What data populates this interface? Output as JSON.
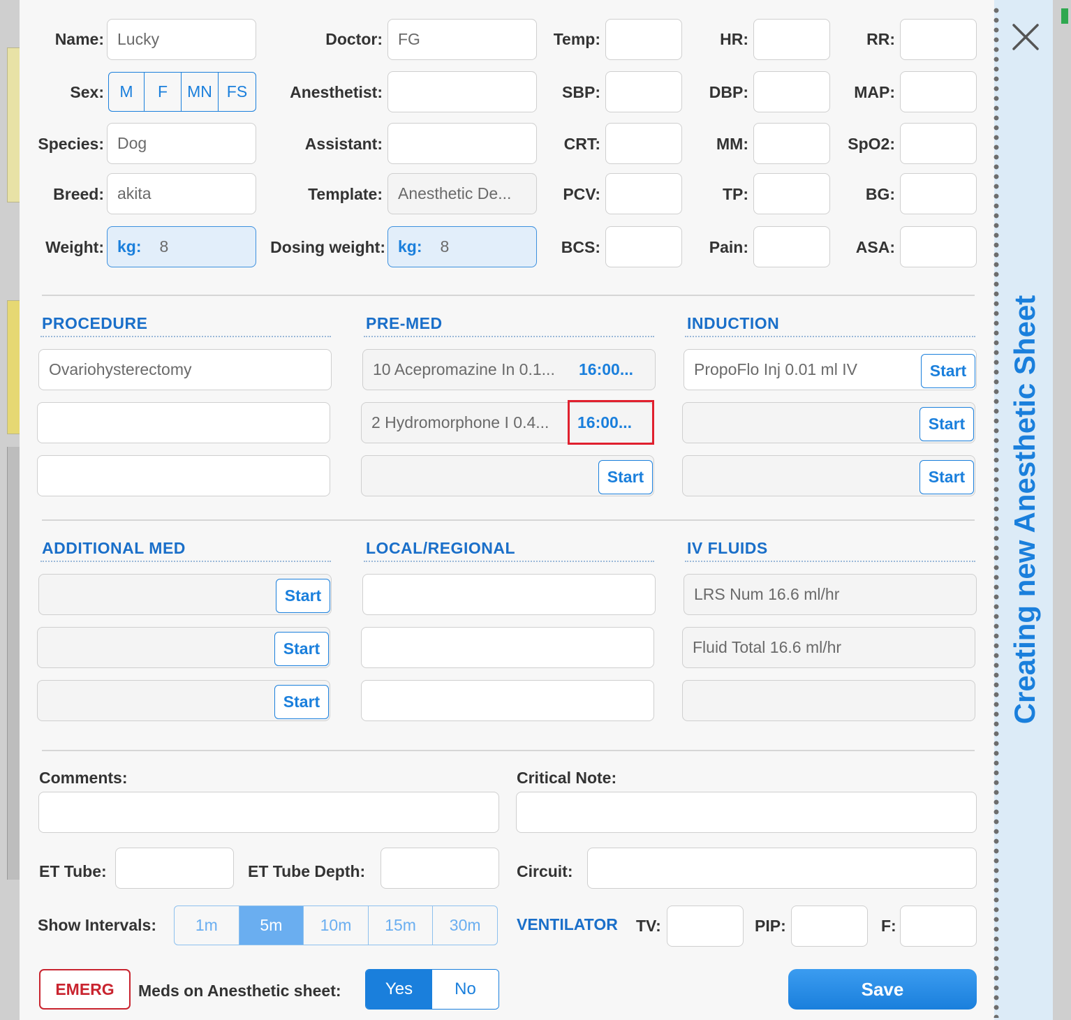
{
  "dialog": {
    "sidebar_title": "Creating new Anesthetic Sheet",
    "close_icon": "close-icon"
  },
  "patient": {
    "name_label": "Name:",
    "name_value": "Lucky",
    "sex_label": "Sex:",
    "sex_options": [
      "M",
      "F",
      "MN",
      "FS"
    ],
    "species_label": "Species:",
    "species_value": "Dog",
    "breed_label": "Breed:",
    "breed_value": "akita",
    "weight_label": "Weight:",
    "weight_unit": "kg:",
    "weight_value": "8",
    "doctor_label": "Doctor:",
    "doctor_value": "FG",
    "anesthetist_label": "Anesthetist:",
    "anesthetist_value": "",
    "assistant_label": "Assistant:",
    "assistant_value": "",
    "template_label": "Template:",
    "template_value": "Anesthetic De...",
    "dosing_weight_label": "Dosing weight:",
    "dosing_weight_unit": "kg:",
    "dosing_weight_value": "8"
  },
  "vitals": {
    "temp": "Temp:",
    "hr": "HR:",
    "rr": "RR:",
    "sbp": "SBP:",
    "dbp": "DBP:",
    "map": "MAP:",
    "crt": "CRT:",
    "mm": "MM:",
    "spo2": "SpO2:",
    "pcv": "PCV:",
    "tp": "TP:",
    "bg": "BG:",
    "bcs": "BCS:",
    "pain": "Pain:",
    "asa": "ASA:"
  },
  "procedure": {
    "title": "PROCEDURE",
    "items": [
      "Ovariohysterectomy",
      "",
      ""
    ]
  },
  "premed": {
    "title": "PRE-MED",
    "items": [
      {
        "text": "10 Acepromazine In 0.1...",
        "time": "16:00..."
      },
      {
        "text": "2 Hydromorphone I 0.4...",
        "time": "16:00..."
      }
    ],
    "start_label": "Start"
  },
  "induction": {
    "title": "INDUCTION",
    "items": [
      "PropoFlo Inj 0.01 ml IV",
      "",
      ""
    ],
    "start_label": "Start"
  },
  "additional_med": {
    "title": "ADDITIONAL MED",
    "start_label": "Start"
  },
  "local_regional": {
    "title": "LOCAL/REGIONAL"
  },
  "iv_fluids": {
    "title": "IV FLUIDS",
    "items": [
      "LRS Num 16.6 ml/hr",
      "Fluid Total 16.6 ml/hr",
      ""
    ]
  },
  "bottom": {
    "comments_label": "Comments:",
    "critical_note_label": "Critical Note:",
    "et_tube_label": "ET Tube:",
    "et_tube_depth_label": "ET Tube Depth:",
    "circuit_label": "Circuit:",
    "show_intervals_label": "Show Intervals:",
    "intervals": [
      "1m",
      "5m",
      "10m",
      "15m",
      "30m"
    ],
    "selected_interval": "5m",
    "ventilator_label": "VENTILATOR",
    "tv_label": "TV:",
    "pip_label": "PIP:",
    "f_label": "F:",
    "emerg_label": "EMERG",
    "meds_label": "Meds on Anesthetic sheet:",
    "yes_label": "Yes",
    "no_label": "No",
    "save_label": "Save"
  },
  "colors": {
    "accent": "#1a7fdc",
    "emerg": "#c9242f",
    "highlight": "#e0202e"
  }
}
